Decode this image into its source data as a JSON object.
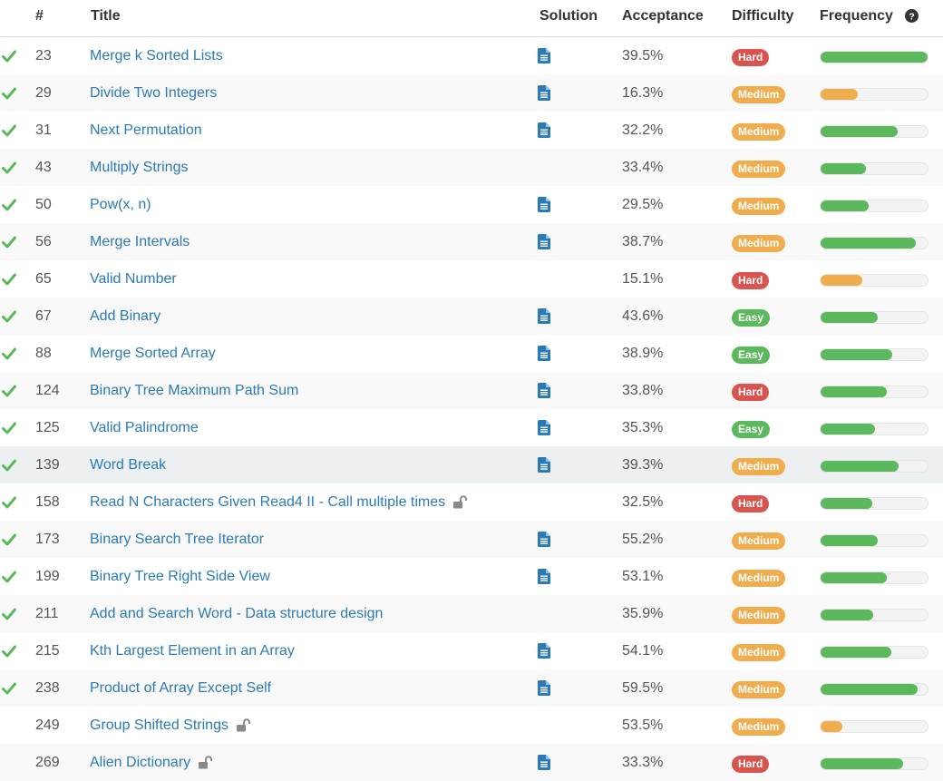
{
  "colors": {
    "link": "#2a7ab8",
    "check": "#5cb85c",
    "hard": "#d9534f",
    "medium": "#f0ad4e",
    "easy": "#5cb85c",
    "bar_green": "#5cb85c",
    "bar_orange": "#f0ad4e",
    "solution_icon": "#2a7ab8",
    "lock_icon": "#8a8a8a"
  },
  "columns": {
    "num": "#",
    "title": "Title",
    "solution": "Solution",
    "acceptance": "Acceptance",
    "difficulty": "Difficulty",
    "frequency": "Frequency",
    "frequency_help_icon": "question-circle-icon"
  },
  "problems": [
    {
      "solved": true,
      "num": "23",
      "title": "Merge k Sorted Lists",
      "locked": false,
      "solution": true,
      "acceptance": "39.5%",
      "difficulty": "Hard",
      "frequency": 1.0,
      "bar": "green"
    },
    {
      "solved": true,
      "num": "29",
      "title": "Divide Two Integers",
      "locked": false,
      "solution": true,
      "acceptance": "16.3%",
      "difficulty": "Medium",
      "frequency": 0.35,
      "bar": "orange"
    },
    {
      "solved": true,
      "num": "31",
      "title": "Next Permutation",
      "locked": false,
      "solution": true,
      "acceptance": "32.2%",
      "difficulty": "Medium",
      "frequency": 0.72,
      "bar": "green"
    },
    {
      "solved": true,
      "num": "43",
      "title": "Multiply Strings",
      "locked": false,
      "solution": false,
      "acceptance": "33.4%",
      "difficulty": "Medium",
      "frequency": 0.42,
      "bar": "green"
    },
    {
      "solved": true,
      "num": "50",
      "title": "Pow(x, n)",
      "locked": false,
      "solution": true,
      "acceptance": "29.5%",
      "difficulty": "Medium",
      "frequency": 0.45,
      "bar": "green"
    },
    {
      "solved": true,
      "num": "56",
      "title": "Merge Intervals",
      "locked": false,
      "solution": true,
      "acceptance": "38.7%",
      "difficulty": "Medium",
      "frequency": 0.89,
      "bar": "green"
    },
    {
      "solved": true,
      "num": "65",
      "title": "Valid Number",
      "locked": false,
      "solution": false,
      "acceptance": "15.1%",
      "difficulty": "Hard",
      "frequency": 0.39,
      "bar": "orange"
    },
    {
      "solved": true,
      "num": "67",
      "title": "Add Binary",
      "locked": false,
      "solution": true,
      "acceptance": "43.6%",
      "difficulty": "Easy",
      "frequency": 0.53,
      "bar": "green"
    },
    {
      "solved": true,
      "num": "88",
      "title": "Merge Sorted Array",
      "locked": false,
      "solution": true,
      "acceptance": "38.9%",
      "difficulty": "Easy",
      "frequency": 0.67,
      "bar": "green"
    },
    {
      "solved": true,
      "num": "124",
      "title": "Binary Tree Maximum Path Sum",
      "locked": false,
      "solution": true,
      "acceptance": "33.8%",
      "difficulty": "Hard",
      "frequency": 0.62,
      "bar": "green"
    },
    {
      "solved": true,
      "num": "125",
      "title": "Valid Palindrome",
      "locked": false,
      "solution": true,
      "acceptance": "35.3%",
      "difficulty": "Easy",
      "frequency": 0.51,
      "bar": "green"
    },
    {
      "solved": true,
      "num": "139",
      "title": "Word Break",
      "locked": false,
      "solution": true,
      "acceptance": "39.3%",
      "difficulty": "Medium",
      "frequency": 0.73,
      "bar": "green",
      "highlighted": true
    },
    {
      "solved": true,
      "num": "158",
      "title": "Read N Characters Given Read4 II - Call multiple times",
      "locked": true,
      "solution": false,
      "acceptance": "32.5%",
      "difficulty": "Hard",
      "frequency": 0.48,
      "bar": "green"
    },
    {
      "solved": true,
      "num": "173",
      "title": "Binary Search Tree Iterator",
      "locked": false,
      "solution": true,
      "acceptance": "55.2%",
      "difficulty": "Medium",
      "frequency": 0.53,
      "bar": "green"
    },
    {
      "solved": true,
      "num": "199",
      "title": "Binary Tree Right Side View",
      "locked": false,
      "solution": true,
      "acceptance": "53.1%",
      "difficulty": "Medium",
      "frequency": 0.62,
      "bar": "green"
    },
    {
      "solved": true,
      "num": "211",
      "title": "Add and Search Word - Data structure design",
      "locked": false,
      "solution": false,
      "acceptance": "35.9%",
      "difficulty": "Medium",
      "frequency": 0.49,
      "bar": "green"
    },
    {
      "solved": true,
      "num": "215",
      "title": "Kth Largest Element in an Array",
      "locked": false,
      "solution": true,
      "acceptance": "54.1%",
      "difficulty": "Medium",
      "frequency": 0.66,
      "bar": "green"
    },
    {
      "solved": true,
      "num": "238",
      "title": "Product of Array Except Self",
      "locked": false,
      "solution": true,
      "acceptance": "59.5%",
      "difficulty": "Medium",
      "frequency": 0.91,
      "bar": "green"
    },
    {
      "solved": false,
      "num": "249",
      "title": "Group Shifted Strings",
      "locked": true,
      "solution": false,
      "acceptance": "53.5%",
      "difficulty": "Medium",
      "frequency": 0.2,
      "bar": "orange"
    },
    {
      "solved": false,
      "num": "269",
      "title": "Alien Dictionary",
      "locked": true,
      "solution": true,
      "acceptance": "33.3%",
      "difficulty": "Hard",
      "frequency": 0.77,
      "bar": "green"
    }
  ]
}
